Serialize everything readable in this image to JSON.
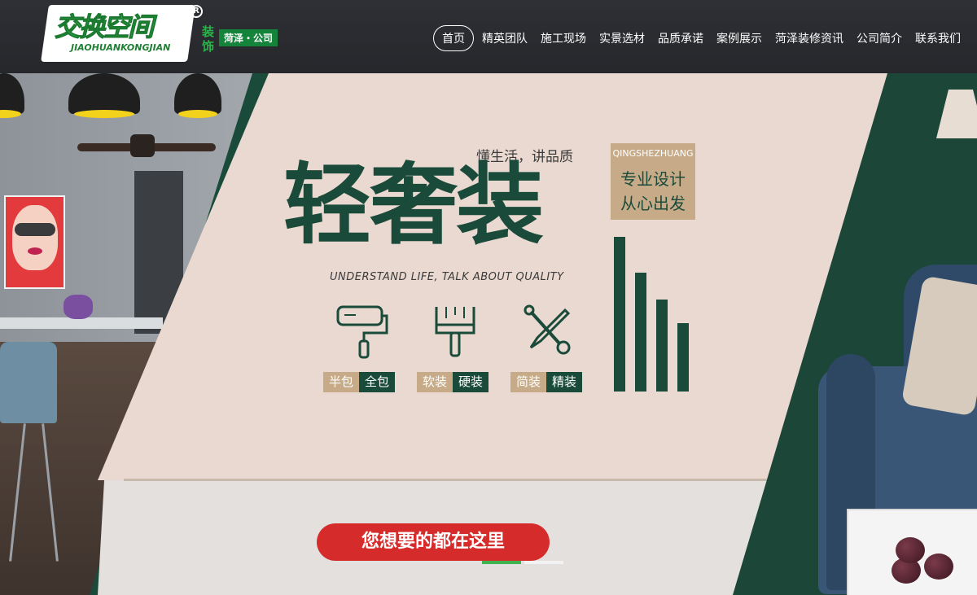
{
  "logo": {
    "name_cn": "交换空间",
    "name_en": "JIAOHUANKONGJIAN",
    "registered_mark": "R",
    "decoration": "装饰",
    "city": "菏泽・公司"
  },
  "nav": {
    "items": [
      {
        "label": "首页",
        "active": true
      },
      {
        "label": "精英团队"
      },
      {
        "label": "施工现场"
      },
      {
        "label": "实景选材"
      },
      {
        "label": "品质承诺"
      },
      {
        "label": "案例展示"
      },
      {
        "label": "菏泽装修资讯"
      },
      {
        "label": "公司简介"
      },
      {
        "label": "联系我们"
      }
    ]
  },
  "banner": {
    "slogan_top": "懂生活，讲品质",
    "title": "轻奢装",
    "subtitle": "UNDERSTAND LIFE, TALK ABOUT QUALITY",
    "badge": {
      "en": "QINGSHEZHUANG",
      "line1": "专业设计",
      "line2": "从心出发"
    },
    "features": [
      {
        "icon": "paint-roller-icon",
        "left": "半包",
        "right": "全包"
      },
      {
        "icon": "paint-brush-icon",
        "left": "软装",
        "right": "硬装"
      },
      {
        "icon": "tools-icon",
        "left": "简装",
        "right": "精装"
      }
    ],
    "cta": "您想要的都在这里",
    "slides": 2,
    "active_slide": 1
  },
  "colors": {
    "dark_green": "#1a4a3a",
    "tan": "#c7ab88",
    "pink": "#ead9d0",
    "cta_red": "#d62b2b",
    "accent_green": "#3fb34f"
  }
}
